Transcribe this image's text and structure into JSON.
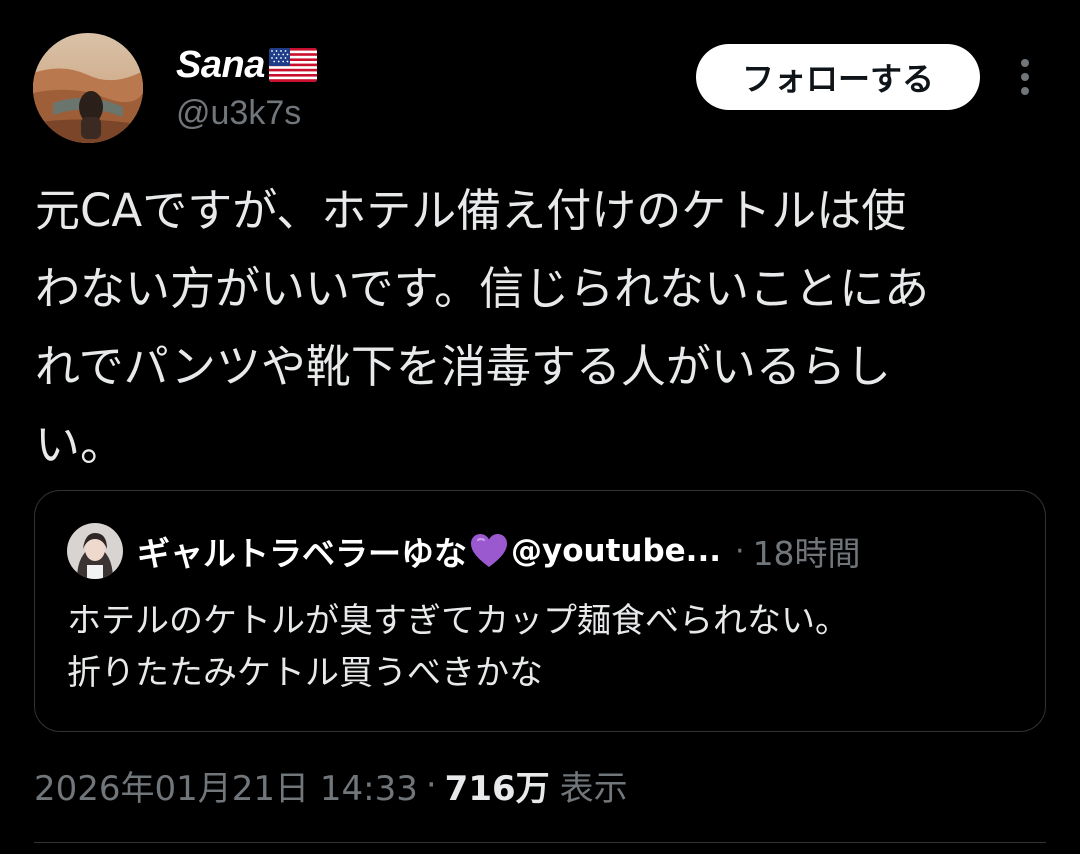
{
  "author": {
    "display_name": "Sana",
    "flag_icon": "us-flag-icon",
    "handle": "@u3k7s"
  },
  "follow_button": {
    "label": "フォローする"
  },
  "more_icon": "more-vertical-icon",
  "tweet": {
    "text": "元CAですが、ホテル備え付けのケトルは使\nわない方がいいです。信じられないことにあ\nれでパンツや靴下を消毒する人がいるらし\nい。"
  },
  "quoted_tweet": {
    "author_name": "ギャルトラベラーゆな",
    "heart_icon": "purple-heart-icon",
    "author_handle": "@youtube...",
    "separator": "·",
    "time": "18時間",
    "text": "ホテルのケトルが臭すぎてカップ麺食べられない。\n折りたたみケトル買うべきかな"
  },
  "meta": {
    "timestamp": "2026年01月21日 14:33",
    "separator": "·",
    "views_count": "716万",
    "views_label": "表示"
  },
  "colors": {
    "background": "#000000",
    "text_primary": "#e7e9ea",
    "text_secondary": "#71767b",
    "border": "#2f3336",
    "button_bg": "#ffffff",
    "heart": "#9b59d0"
  }
}
